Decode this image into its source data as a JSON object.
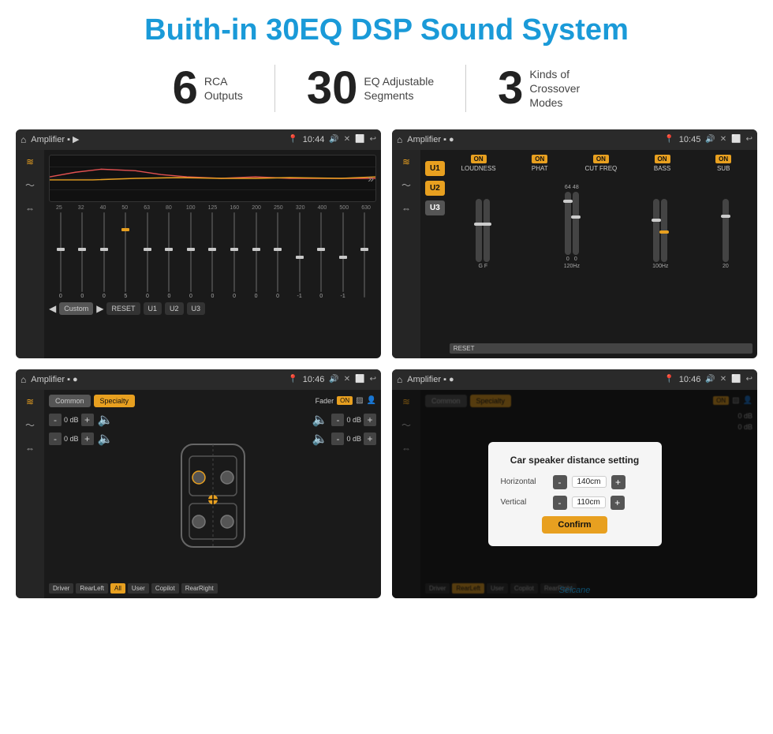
{
  "header": {
    "title": "Buith-in 30EQ DSP Sound System"
  },
  "stats": [
    {
      "number": "6",
      "label": "RCA\nOutputs"
    },
    {
      "number": "30",
      "label": "EQ Adjustable\nSegments"
    },
    {
      "number": "3",
      "label": "Kinds of\nCrossover Modes"
    }
  ],
  "screens": [
    {
      "id": "screen1",
      "topbar": {
        "title": "Amplifier",
        "time": "10:44"
      },
      "type": "eq"
    },
    {
      "id": "screen2",
      "topbar": {
        "title": "Amplifier",
        "time": "10:45"
      },
      "type": "amp"
    },
    {
      "id": "screen3",
      "topbar": {
        "title": "Amplifier",
        "time": "10:46"
      },
      "type": "fader"
    },
    {
      "id": "screen4",
      "topbar": {
        "title": "Amplifier",
        "time": "10:46"
      },
      "type": "fader-dialog"
    }
  ],
  "eq": {
    "frequencies": [
      "25",
      "32",
      "40",
      "50",
      "63",
      "80",
      "100",
      "125",
      "160",
      "200",
      "250",
      "320",
      "400",
      "500",
      "630"
    ],
    "values": [
      "0",
      "0",
      "0",
      "5",
      "0",
      "0",
      "0",
      "0",
      "0",
      "0",
      "0",
      "-1",
      "0",
      "-1"
    ],
    "buttons": [
      "Custom",
      "RESET",
      "U1",
      "U2",
      "U3"
    ]
  },
  "amp": {
    "user_buttons": [
      "U1",
      "U2",
      "U3"
    ],
    "toggles": [
      "LOUDNESS",
      "PHAT",
      "CUT FREQ",
      "BASS",
      "SUB"
    ],
    "reset_label": "RESET"
  },
  "fader": {
    "tabs": [
      "Common",
      "Specialty"
    ],
    "fader_label": "Fader",
    "on_label": "ON",
    "db_values": [
      "0 dB",
      "0 dB",
      "0 dB",
      "0 dB"
    ],
    "position_buttons": [
      "Driver",
      "RearLeft",
      "All",
      "User",
      "Copilot",
      "RearRight"
    ]
  },
  "dialog": {
    "title": "Car speaker distance setting",
    "horizontal_label": "Horizontal",
    "horizontal_value": "140cm",
    "vertical_label": "Vertical",
    "vertical_value": "110cm",
    "confirm_label": "Confirm"
  },
  "watermark": "Seicane"
}
